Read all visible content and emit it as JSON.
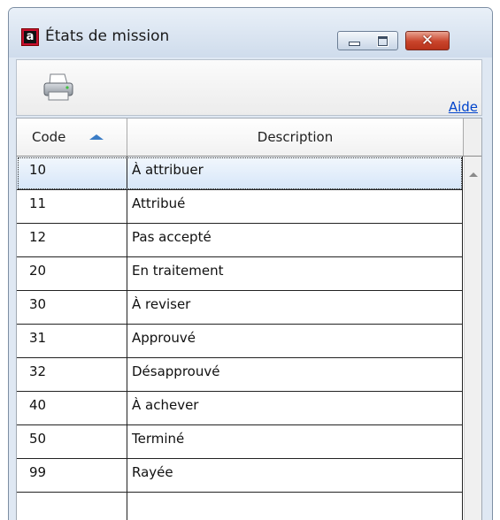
{
  "window": {
    "title": "États de mission",
    "logo_letter": "a",
    "close_glyph": "✕"
  },
  "toolbar": {
    "print_icon": "printer-icon",
    "help_label": "Aide"
  },
  "table": {
    "columns": [
      "Code",
      "Description"
    ],
    "sort": {
      "column": "Code",
      "direction": "ascending"
    },
    "selected_row": 0,
    "rows": [
      {
        "code": "10",
        "description": "À attribuer"
      },
      {
        "code": "11",
        "description": "Attribué"
      },
      {
        "code": "12",
        "description": "Pas accepté"
      },
      {
        "code": "20",
        "description": "En traitement"
      },
      {
        "code": "30",
        "description": "À reviser"
      },
      {
        "code": "31",
        "description": "Approuvé"
      },
      {
        "code": "32",
        "description": "Désapprouvé"
      },
      {
        "code": "40",
        "description": "À achever"
      },
      {
        "code": "50",
        "description": "Terminé"
      },
      {
        "code": "99",
        "description": "Rayée"
      }
    ]
  },
  "colors": {
    "accent": "#3a7cc6",
    "link": "#0044cc",
    "close_button": "#c9442b",
    "logo_red": "#c8102e"
  }
}
